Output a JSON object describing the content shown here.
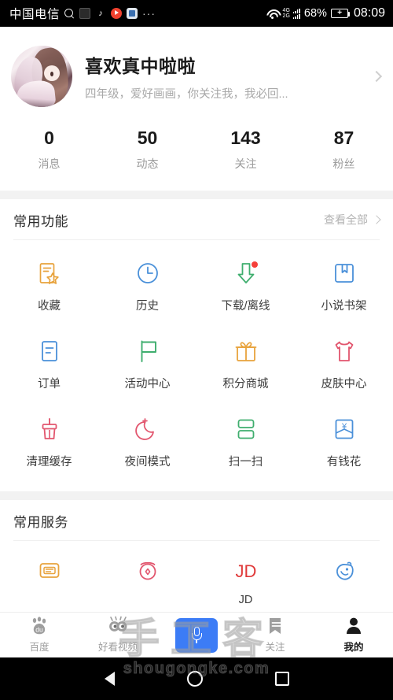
{
  "status_bar": {
    "carrier": "中国电信",
    "search_icon": "search-icon",
    "notif_apps": [
      "shougongke-app-icon",
      "douyin-app-icon",
      "media-player-app-icon",
      "blue-app-icon"
    ],
    "overflow": "···",
    "wifi_icon": "wifi-icon",
    "signal_primary": "4G",
    "signal_secondary": "2G",
    "battery_percent": "68%",
    "battery_icon": "battery-charging-icon",
    "clock": "08:09"
  },
  "profile": {
    "avatar_name": "user-avatar",
    "name": "喜欢真中啦啦",
    "description": "四年级，爱好画画，你关注我，我必回...",
    "chevron": "chevron-right-icon"
  },
  "stats": [
    {
      "value": "0",
      "label": "消息"
    },
    {
      "value": "50",
      "label": "动态"
    },
    {
      "value": "143",
      "label": "关注"
    },
    {
      "value": "87",
      "label": "粉丝"
    }
  ],
  "functions_section": {
    "title": "常用功能",
    "more_label": "查看全部",
    "more_chevron": "chevron-right-icon",
    "items": [
      {
        "label": "收藏",
        "icon": "bookmark-star-icon",
        "color": "#e8a33d",
        "badge": false
      },
      {
        "label": "历史",
        "icon": "clock-icon",
        "color": "#4a90d9",
        "badge": false
      },
      {
        "label": "下载/离线",
        "icon": "download-arrow-icon",
        "color": "#3fae6e",
        "badge": true
      },
      {
        "label": "小说书架",
        "icon": "book-shelf-icon",
        "color": "#4a90d9",
        "badge": false
      },
      {
        "label": "订单",
        "icon": "order-document-icon",
        "color": "#4a90d9",
        "badge": false
      },
      {
        "label": "活动中心",
        "icon": "flag-icon",
        "color": "#3fae6e",
        "badge": false
      },
      {
        "label": "积分商城",
        "icon": "gift-icon",
        "color": "#e8a33d",
        "badge": false
      },
      {
        "label": "皮肤中心",
        "icon": "tshirt-icon",
        "color": "#e2566e",
        "badge": false
      },
      {
        "label": "清理缓存",
        "icon": "broom-clean-icon",
        "color": "#e2566e",
        "badge": false
      },
      {
        "label": "夜间模式",
        "icon": "moon-icon",
        "color": "#e2566e",
        "badge": false
      },
      {
        "label": "扫一扫",
        "icon": "scan-code-icon",
        "color": "#3fae6e",
        "badge": false
      },
      {
        "label": "有钱花",
        "icon": "money-card-icon",
        "color": "#4a90d9",
        "badge": false
      }
    ]
  },
  "services_section": {
    "title": "常用服务",
    "items": [
      {
        "label": "",
        "icon": "card-wallet-icon",
        "color": "#e8a33d"
      },
      {
        "label": "",
        "icon": "taobao-circle-icon",
        "color": "#e2566e"
      },
      {
        "label": "JD",
        "icon": "jd-text-icon",
        "color": "#e03a3a"
      },
      {
        "label": "",
        "icon": "xianyu-fish-icon",
        "color": "#4a90d9"
      }
    ]
  },
  "bottom_nav": {
    "items": [
      {
        "label": "百度",
        "icon": "baidu-paw-icon",
        "active": false
      },
      {
        "label": "好看视频",
        "icon": "haokan-eyes-icon",
        "active": false
      },
      {
        "label": "",
        "icon": "microphone-icon",
        "active": false
      },
      {
        "label": "关注",
        "icon": "bookmark-icon",
        "active": false
      },
      {
        "label": "我的",
        "icon": "person-icon",
        "active": true
      }
    ],
    "mic_color": "#3c7cf6"
  },
  "system_nav": {
    "back": "back-triangle-icon",
    "home": "home-circle-icon",
    "recents": "recents-square-icon"
  },
  "watermark": {
    "big": "手工客",
    "small": "shougongke.com"
  }
}
